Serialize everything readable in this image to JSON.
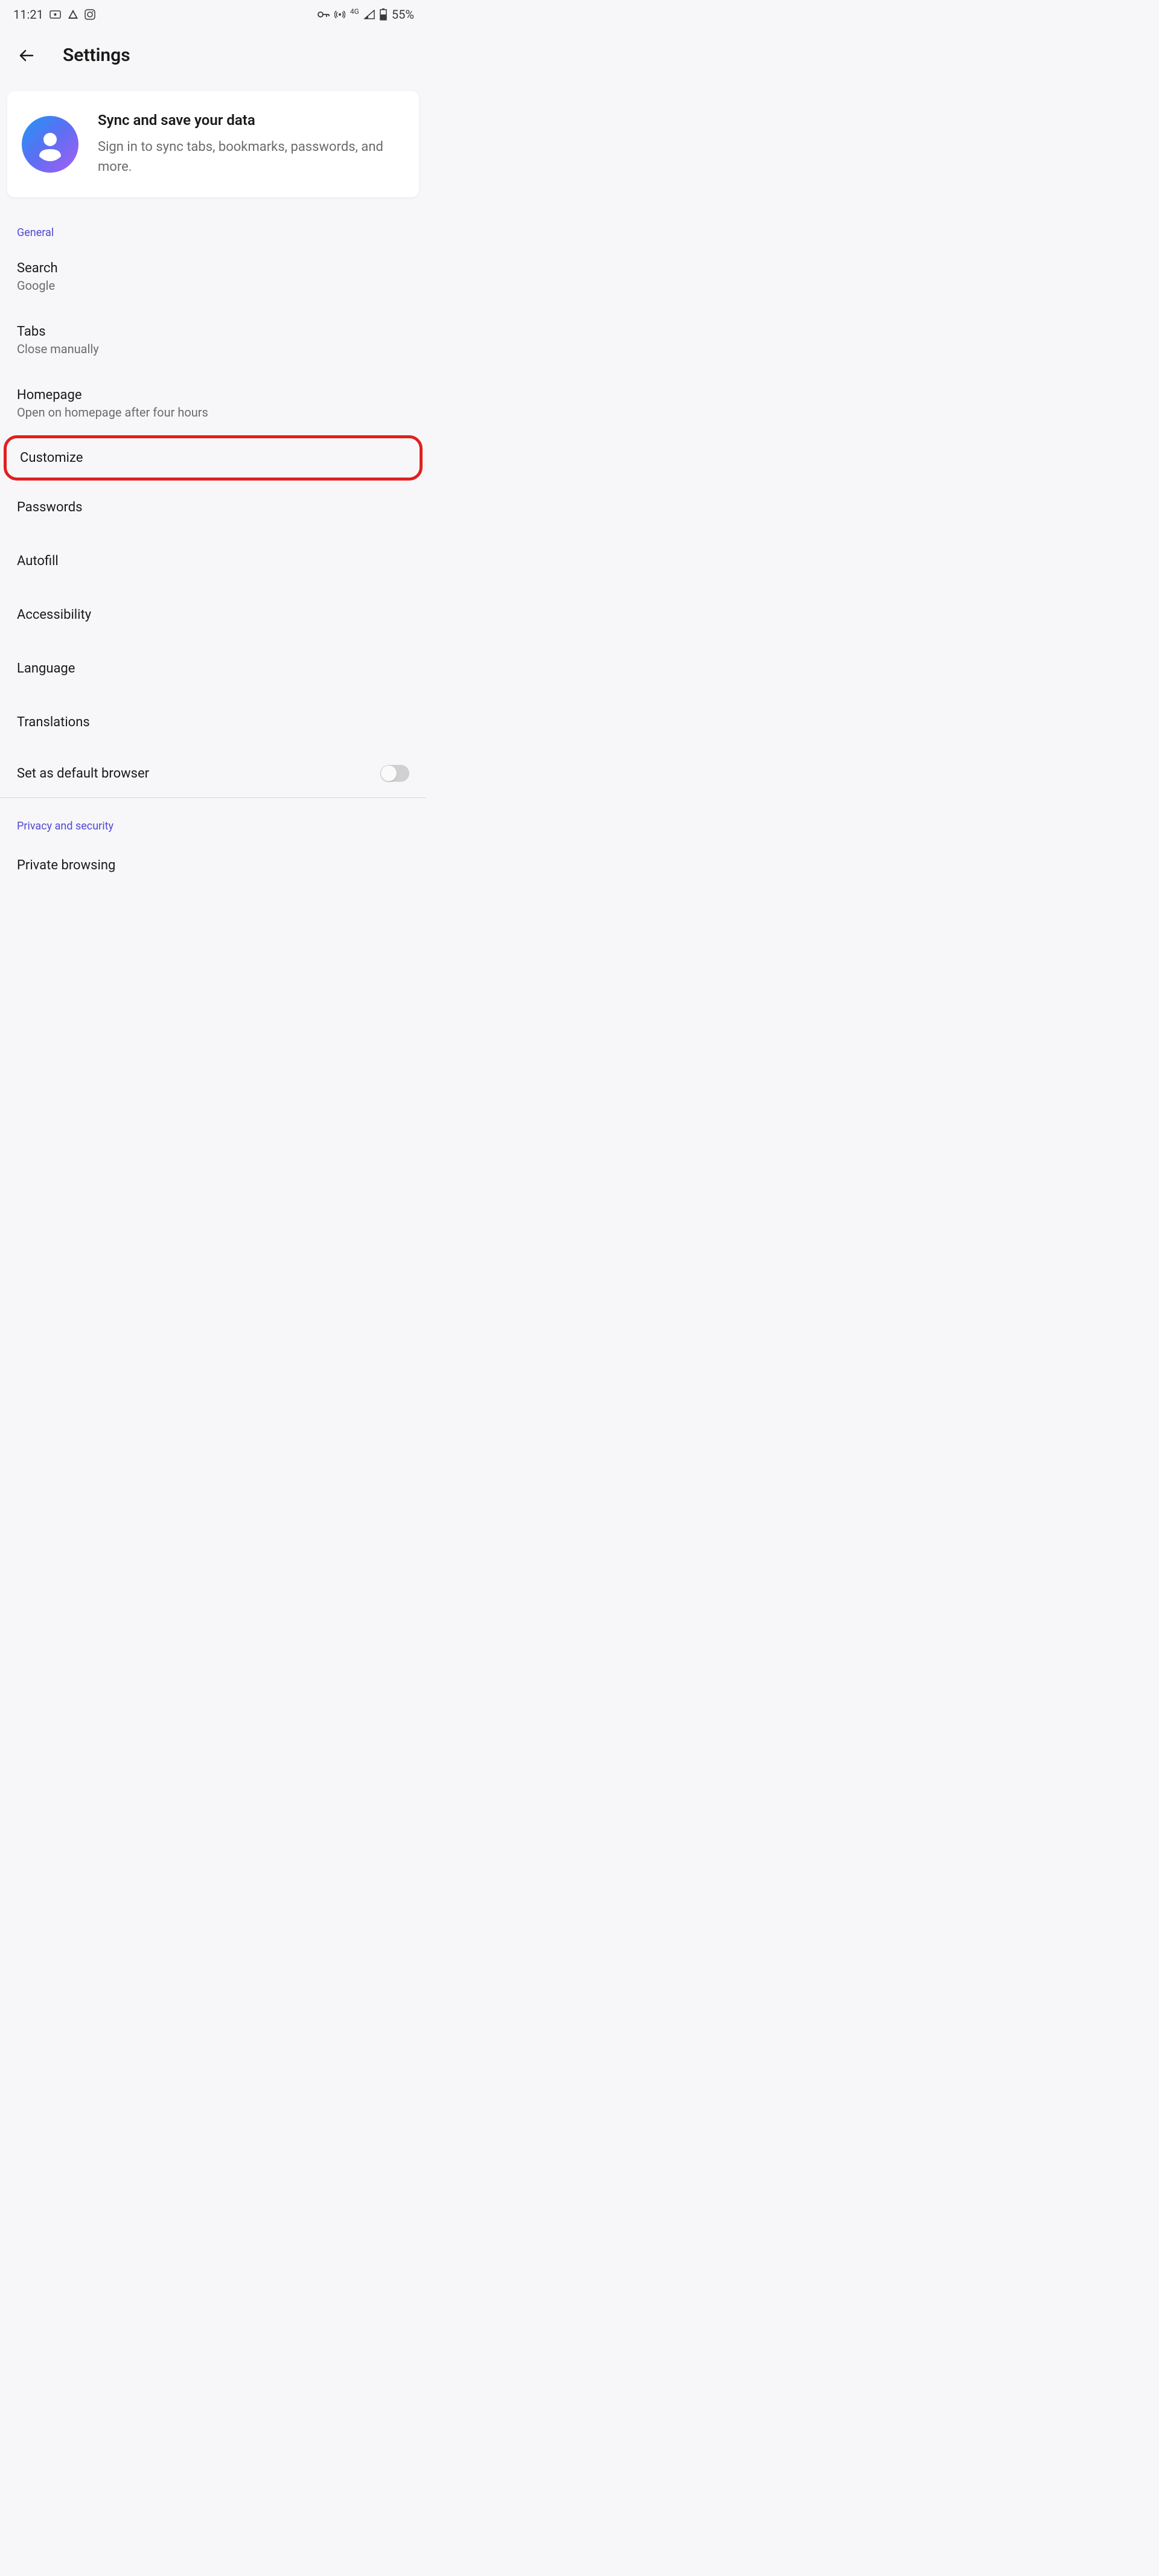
{
  "statusBar": {
    "time": "11:21",
    "networkType": "4G",
    "battery": "55%"
  },
  "header": {
    "title": "Settings"
  },
  "syncCard": {
    "title": "Sync and save your data",
    "subtitle": "Sign in to sync tabs, bookmarks, passwords, and more."
  },
  "sections": {
    "general": {
      "label": "General",
      "items": {
        "search": {
          "title": "Search",
          "subtitle": "Google"
        },
        "tabs": {
          "title": "Tabs",
          "subtitle": "Close manually"
        },
        "homepage": {
          "title": "Homepage",
          "subtitle": "Open on homepage after four hours"
        },
        "customize": {
          "title": "Customize"
        },
        "passwords": {
          "title": "Passwords"
        },
        "autofill": {
          "title": "Autofill"
        },
        "accessibility": {
          "title": "Accessibility"
        },
        "language": {
          "title": "Language"
        },
        "translations": {
          "title": "Translations"
        },
        "defaultBrowser": {
          "title": "Set as default browser"
        }
      }
    },
    "privacy": {
      "label": "Privacy and security",
      "items": {
        "privateBrowsing": {
          "title": "Private browsing"
        }
      }
    }
  }
}
